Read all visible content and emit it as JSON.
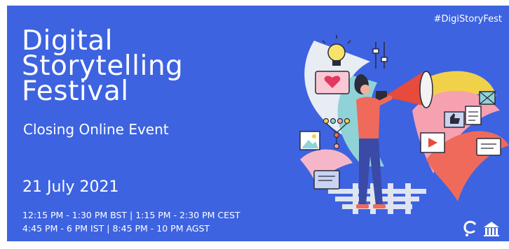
{
  "banner": {
    "hashtag": "#DigiStoryFest",
    "title_lines": [
      "Digital",
      "Storytelling",
      "Festival"
    ],
    "subtitle": "Closing Online Event",
    "date": "21 July  2021",
    "time_lines": [
      "12:15 PM - 1:30 PM BST | 1:15 PM - 2:30 PM CEST",
      "4:45 PM - 6 PM IST | 8:45 PM - 10 PM AGST"
    ],
    "colors": {
      "background": "#3d63e0",
      "text": "#ffffff"
    },
    "illustration_icons": [
      "lightbulb-icon",
      "heart-icon",
      "megaphone-icon",
      "image-icon",
      "network-icon",
      "thumbs-up-icon",
      "document-icon",
      "play-icon",
      "envelope-icon",
      "chat-icon"
    ]
  }
}
